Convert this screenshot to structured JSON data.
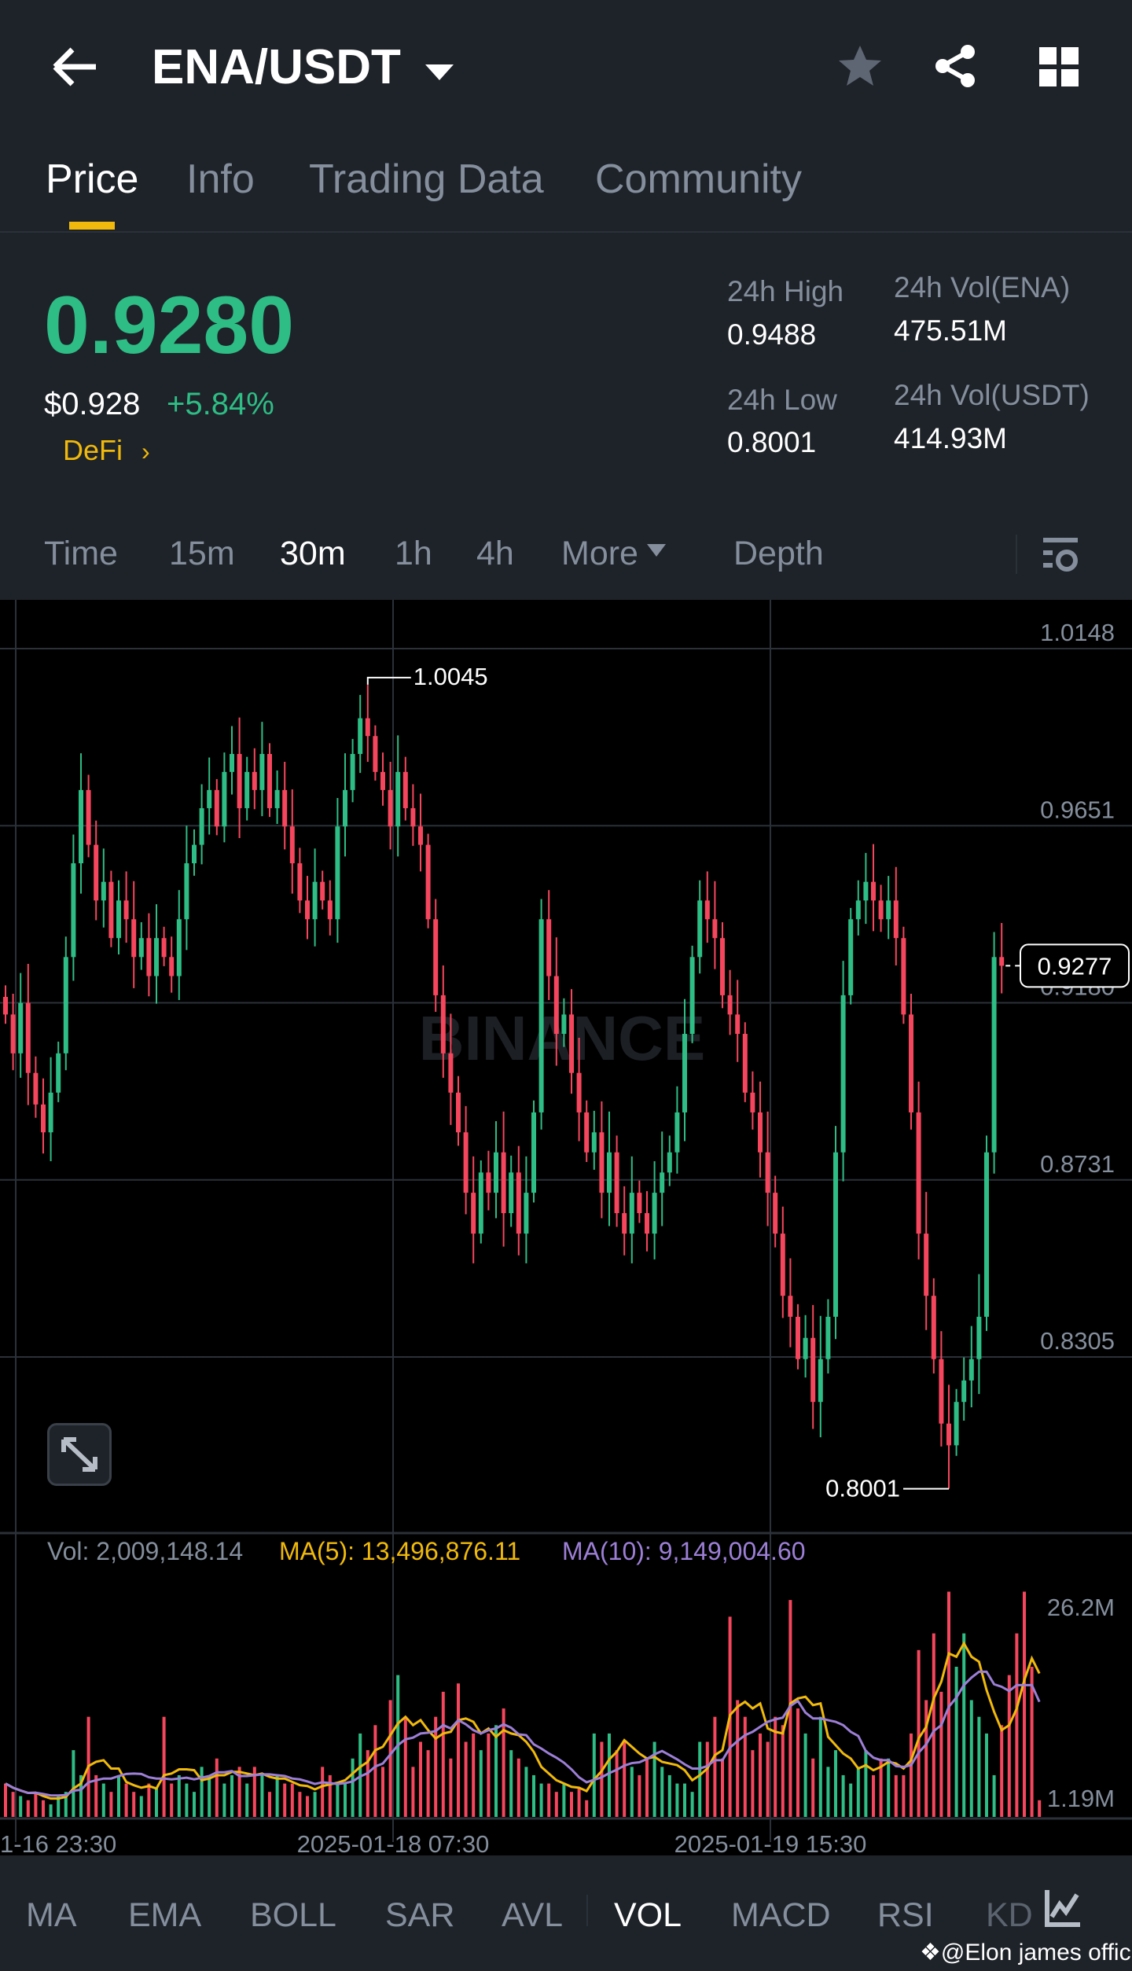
{
  "header": {
    "title": "ENA/USDT",
    "back": "arrow-left-icon",
    "icons": [
      "star-icon",
      "share-icon",
      "grid-icon"
    ]
  },
  "tabs": [
    "Price",
    "Info",
    "Trading Data",
    "Community"
  ],
  "ticker": {
    "price": "0.9280",
    "usd": "$0.928",
    "change": "+5.84%",
    "sector": "DeFi",
    "stats": [
      {
        "label": "24h High",
        "value": "0.9488"
      },
      {
        "label": "24h Vol(ENA)",
        "value": "475.51M"
      },
      {
        "label": "24h Low",
        "value": "0.8001"
      },
      {
        "label": "24h Vol(USDT)",
        "value": "414.93M"
      }
    ]
  },
  "intervals": [
    "Time",
    "15m",
    "30m",
    "1h",
    "4h",
    "More",
    "Depth"
  ],
  "active_interval": "30m",
  "indicators": [
    "MA",
    "EMA",
    "BOLL",
    "SAR",
    "AVL",
    "VOL",
    "MACD",
    "RSI",
    "KD"
  ],
  "watermark": "BINANCE",
  "credit": "@Elon james official",
  "colors": {
    "up": "#2ebd85",
    "down": "#f6465d",
    "accent": "#f0b90b",
    "ma5": "#f0b90b",
    "ma10": "#9c7fd6"
  },
  "chart_data": {
    "type": "candlestick",
    "price_axis": [
      "1.0148",
      "0.9651",
      "0.9180",
      "0.8731",
      "0.8305"
    ],
    "price_range": [
      0.8305,
      1.0148
    ],
    "scale": "log",
    "high_label": "1.0045",
    "low_label": "0.8001",
    "last_price": "0.9277",
    "x_labels": [
      "1-16 23:30",
      "2025-01-18 07:30",
      "2025-01-19 15:30"
    ],
    "closes": [
      0.915,
      0.905,
      0.918,
      0.9,
      0.892,
      0.885,
      0.895,
      0.905,
      0.93,
      0.955,
      0.975,
      0.96,
      0.945,
      0.95,
      0.935,
      0.945,
      0.94,
      0.93,
      0.935,
      0.925,
      0.935,
      0.93,
      0.925,
      0.94,
      0.955,
      0.96,
      0.97,
      0.975,
      0.965,
      0.98,
      0.985,
      0.97,
      0.98,
      0.975,
      0.985,
      0.97,
      0.975,
      0.965,
      0.955,
      0.945,
      0.94,
      0.95,
      0.945,
      0.94,
      0.965,
      0.975,
      0.985,
      0.995,
      0.99,
      0.98,
      0.975,
      0.965,
      0.98,
      0.97,
      0.965,
      0.96,
      0.94,
      0.92,
      0.905,
      0.895,
      0.885,
      0.87,
      0.86,
      0.875,
      0.87,
      0.88,
      0.865,
      0.875,
      0.86,
      0.87,
      0.89,
      0.94,
      0.925,
      0.91,
      0.915,
      0.9,
      0.89,
      0.88,
      0.885,
      0.87,
      0.88,
      0.865,
      0.86,
      0.87,
      0.865,
      0.86,
      0.87,
      0.875,
      0.88,
      0.89,
      0.91,
      0.93,
      0.945,
      0.94,
      0.935,
      0.92,
      0.915,
      0.91,
      0.895,
      0.89,
      0.88,
      0.87,
      0.86,
      0.845,
      0.84,
      0.83,
      0.835,
      0.82,
      0.83,
      0.84,
      0.88,
      0.92,
      0.94,
      0.945,
      0.95,
      0.945,
      0.94,
      0.945,
      0.935,
      0.915,
      0.89,
      0.86,
      0.845,
      0.83,
      0.815,
      0.81,
      0.82,
      0.825,
      0.83,
      0.84,
      0.88,
      0.93,
      0.9277
    ],
    "volume": {
      "legend": {
        "vol": "Vol: 2,009,148.14",
        "ma5": "MA(5): 13,496,876.11",
        "ma10": "MA(10): 9,149,004.60"
      },
      "axis": [
        "26.2M",
        "1.19M"
      ],
      "values_m": [
        4,
        3,
        2.5,
        2,
        3,
        2,
        1.5,
        2.5,
        3,
        8,
        5,
        12,
        5,
        4,
        3,
        5,
        4,
        3,
        2.5,
        4,
        3.5,
        12,
        4,
        5,
        4,
        3,
        6,
        5,
        7,
        4,
        5,
        6,
        4,
        6,
        5,
        3,
        5,
        4,
        4,
        3,
        2.5,
        3,
        6,
        5,
        4,
        4,
        7,
        10,
        8,
        11,
        6,
        14,
        17,
        12,
        6,
        9,
        8,
        12,
        15,
        7,
        16,
        9,
        10,
        8,
        10,
        11,
        13,
        8,
        7,
        6,
        5,
        4,
        4,
        3,
        4,
        3,
        3.5,
        2,
        10,
        9,
        10,
        8,
        9,
        6,
        5,
        7,
        9,
        6,
        5,
        4,
        4,
        3,
        9,
        9,
        12,
        7,
        24,
        14,
        12,
        8,
        10,
        9,
        12,
        11,
        26,
        13,
        10,
        7,
        12,
        6,
        8,
        5,
        4,
        6,
        8,
        5,
        7,
        7,
        5,
        5,
        10,
        20,
        14,
        22,
        15,
        27,
        18,
        22,
        14,
        12,
        10,
        5,
        11,
        17,
        22,
        27,
        18,
        2
      ]
    }
  }
}
